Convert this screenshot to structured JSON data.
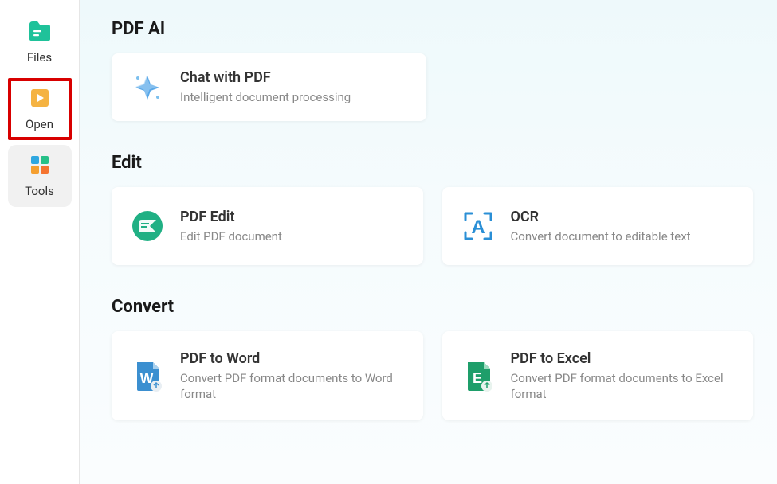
{
  "sidebar": {
    "items": [
      {
        "label": "Files"
      },
      {
        "label": "Open"
      },
      {
        "label": "Tools"
      }
    ]
  },
  "sections": {
    "pdf_ai": {
      "title": "PDF AI",
      "cards": [
        {
          "title": "Chat with PDF",
          "desc": "Intelligent document processing"
        }
      ]
    },
    "edit": {
      "title": "Edit",
      "cards": [
        {
          "title": "PDF Edit",
          "desc": "Edit PDF document"
        },
        {
          "title": "OCR",
          "desc": "Convert document to editable text"
        }
      ]
    },
    "convert": {
      "title": "Convert",
      "cards": [
        {
          "title": "PDF to Word",
          "desc": "Convert PDF format documents to Word format"
        },
        {
          "title": "PDF to Excel",
          "desc": "Convert PDF format documents to Excel format"
        }
      ]
    }
  }
}
